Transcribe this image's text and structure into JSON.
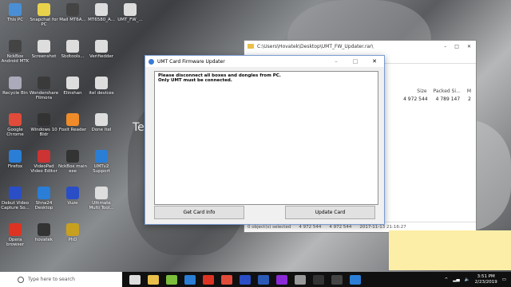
{
  "desktop": {
    "icons": [
      {
        "label": "This PC",
        "color": "#4a8fd6"
      },
      {
        "label": "Snapchat for PC",
        "color": "#e9d24b"
      },
      {
        "label": "Mail MT6A...",
        "color": "#444"
      },
      {
        "label": "MT6580_A...",
        "color": "#ddd"
      },
      {
        "label": "UMT_FW_...",
        "color": "#ddd"
      },
      {
        "label": "NckBox Android MTK",
        "color": "#444"
      },
      {
        "label": "Screenshot",
        "color": "#ddd"
      },
      {
        "label": "Sbdtools...",
        "color": "#ddd"
      },
      {
        "label": "Verifiedder",
        "color": "#ddd"
      },
      {
        "label": "Recycle Bin",
        "color": "#aab"
      },
      {
        "label": "Wondershare Filmora",
        "color": "#3a3a3a"
      },
      {
        "label": "Elinshan",
        "color": "#ddd"
      },
      {
        "label": "itel devices",
        "color": "#ddd"
      },
      {
        "label": "Google Chrome",
        "color": "#e04b3a"
      },
      {
        "label": "Windows 10 Bldr",
        "color": "#333"
      },
      {
        "label": "Foxit Reader",
        "color": "#f08b2a"
      },
      {
        "label": "Done itel",
        "color": "#ddd"
      },
      {
        "label": "Firefox",
        "color": "#2a7ed6"
      },
      {
        "label": "VideoPad Video Editor",
        "color": "#c33"
      },
      {
        "label": "NckBox main exe",
        "color": "#333"
      },
      {
        "label": "UMTv2 Support",
        "color": "#2a7ed6"
      },
      {
        "label": "Debut Video Capture So...",
        "color": "#2a4ec6"
      },
      {
        "label": "Shna24 Desktop",
        "color": "#2a7ed6"
      },
      {
        "label": "Vuze",
        "color": "#2a4ec6"
      },
      {
        "label": "Ultimate Multi Tool...",
        "color": "#ddd"
      },
      {
        "label": "Opera browser",
        "color": "#d32"
      },
      {
        "label": "hovatek",
        "color": "#333"
      },
      {
        "label": "PhD",
        "color": "#c8a020"
      }
    ],
    "side_text": "Te"
  },
  "explorer": {
    "path": "C:\\Users\\Hovatek\\Desktop\\UMT_FW_Updater.rar\\",
    "columns": [
      "Size",
      "Packed Si...",
      "M"
    ],
    "row": [
      "4 972 544",
      "4 789 147",
      "2"
    ],
    "status": [
      "0 object(s) selected",
      "4 972 544",
      "4 972 544",
      "2017-11-13 21:16:27"
    ]
  },
  "dialog": {
    "title": "UMT Card Firmware Updater",
    "messages": [
      "Please disconnect all boxes and dongles from PC.",
      "Only UMT must be connected."
    ],
    "buttons": {
      "get_card_info": "Get Card Info",
      "update_card": "Update Card"
    }
  },
  "taskbar": {
    "search_placeholder": "Type here to search",
    "pinned": [
      {
        "name": "task-view",
        "color": "#ddd"
      },
      {
        "name": "file-explorer",
        "color": "#e9c04b"
      },
      {
        "name": "android-app",
        "color": "#7bbf3b"
      },
      {
        "name": "edge",
        "color": "#2a7ed6"
      },
      {
        "name": "opera",
        "color": "#d32"
      },
      {
        "name": "chrome",
        "color": "#e04b3a"
      },
      {
        "name": "shield",
        "color": "#2a4ec6"
      },
      {
        "name": "word",
        "color": "#2a5ab6"
      },
      {
        "name": "video",
        "color": "#8a2ad6"
      },
      {
        "name": "camera",
        "color": "#999"
      },
      {
        "name": "7zip",
        "color": "#333"
      },
      {
        "name": "vpn",
        "color": "#444"
      },
      {
        "name": "app",
        "color": "#2a7ed6"
      }
    ],
    "time": "3:51 PM",
    "date": "2/23/2019"
  },
  "colors": {
    "accent": "#7a9cd3",
    "taskbar": "#101010",
    "note": "#fdeea7"
  }
}
